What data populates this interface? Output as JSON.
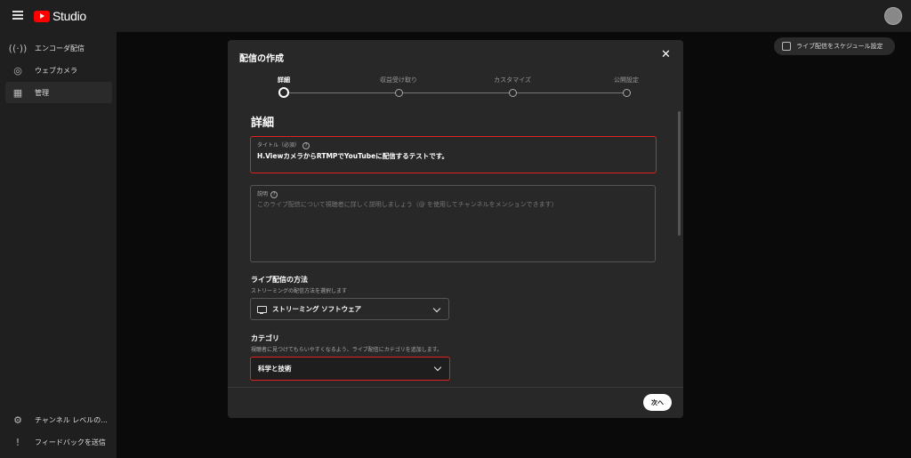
{
  "app": {
    "logo_text": "Studio"
  },
  "sidebar": {
    "items": [
      {
        "label": "エンコーダ配信",
        "icon": "broadcast-icon"
      },
      {
        "label": "ウェブカメラ",
        "icon": "camera-icon"
      },
      {
        "label": "管理",
        "icon": "calendar-icon"
      }
    ],
    "bottom_items": [
      {
        "label": "チャンネル レベルの...",
        "icon": "gear-icon"
      },
      {
        "label": "フィードバックを送信",
        "icon": "feedback-icon"
      }
    ]
  },
  "header": {
    "schedule_button": "ライブ配信をスケジュール設定"
  },
  "modal": {
    "title": "配信の作成",
    "steps": [
      "詳細",
      "収益受け取り",
      "カスタマイズ",
      "公開設定"
    ],
    "active_step": 0,
    "section_title": "詳細",
    "title_field": {
      "label": "タイトル（必須）",
      "value": "H.ViewカメラからRTMPでYouTubeに配信するテストです。"
    },
    "description_field": {
      "label": "説明",
      "placeholder": "このライブ配信について視聴者に詳しく説明しましょう（@ を使用してチャンネルをメンションできます）"
    },
    "method": {
      "title": "ライブ配信の方法",
      "subtitle": "ストリーミングの配信方法を選択します",
      "value": "ストリーミング ソフトウェア"
    },
    "category": {
      "title": "カテゴリ",
      "subtitle": "視聴者に見つけてもらいやすくなるよう、ライブ配信にカテゴリを追加します。",
      "value": "科学と技術"
    },
    "next_label": "次へ"
  },
  "colors": {
    "accent_red": "#dd2222",
    "background": "#0f0f0f",
    "modal_bg": "#282828"
  }
}
